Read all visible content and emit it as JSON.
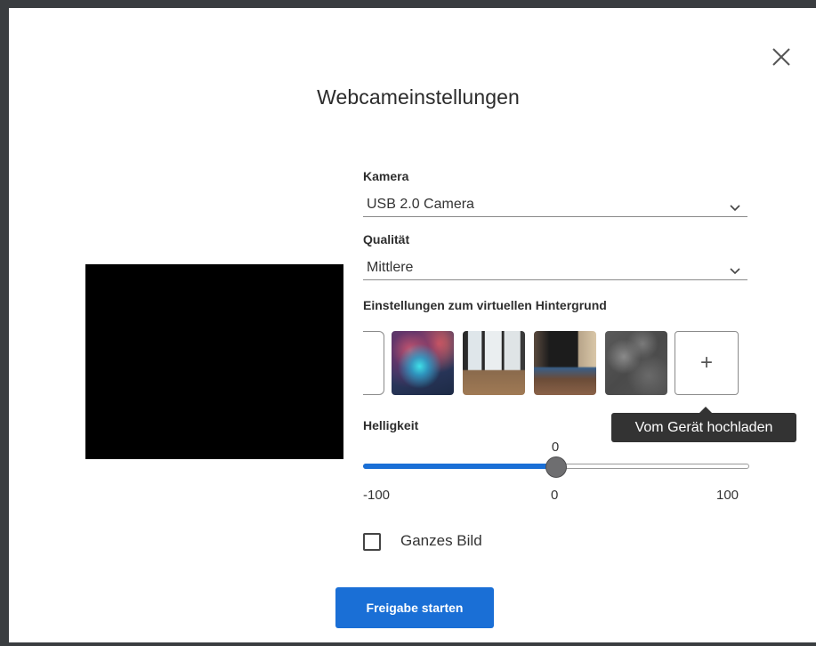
{
  "dialog": {
    "title": "Webcameinstellungen",
    "close_icon": "close-icon"
  },
  "camera": {
    "label": "Kamera",
    "value": "USB 2.0 Camera",
    "icon": "chevron-down-icon"
  },
  "quality": {
    "label": "Qualität",
    "value": "Mittlere",
    "icon": "chevron-down-icon"
  },
  "virtual_background": {
    "label": "Einstellungen zum virtuellen Hintergrund",
    "items": [
      {
        "kind": "none"
      },
      {
        "kind": "image",
        "icon": "aurora-image"
      },
      {
        "kind": "image",
        "icon": "office-image"
      },
      {
        "kind": "image",
        "icon": "office-image"
      },
      {
        "kind": "image",
        "icon": "stone-texture-image"
      }
    ],
    "upload": {
      "symbol": "+",
      "icon": "plus-icon",
      "tooltip": "Vom Gerät hochladen"
    }
  },
  "brightness": {
    "label": "Helligkeit",
    "value": 0,
    "value_text": "0",
    "min": -100,
    "max": 100,
    "min_label": "-100",
    "mid_label": "0",
    "max_label": "100",
    "accent_color": "#1a6fd6"
  },
  "full_image": {
    "label": "Ganzes Bild",
    "checked": false
  },
  "actions": {
    "primary_label": "Freigabe starten",
    "primary_color": "#1a6fd6"
  }
}
